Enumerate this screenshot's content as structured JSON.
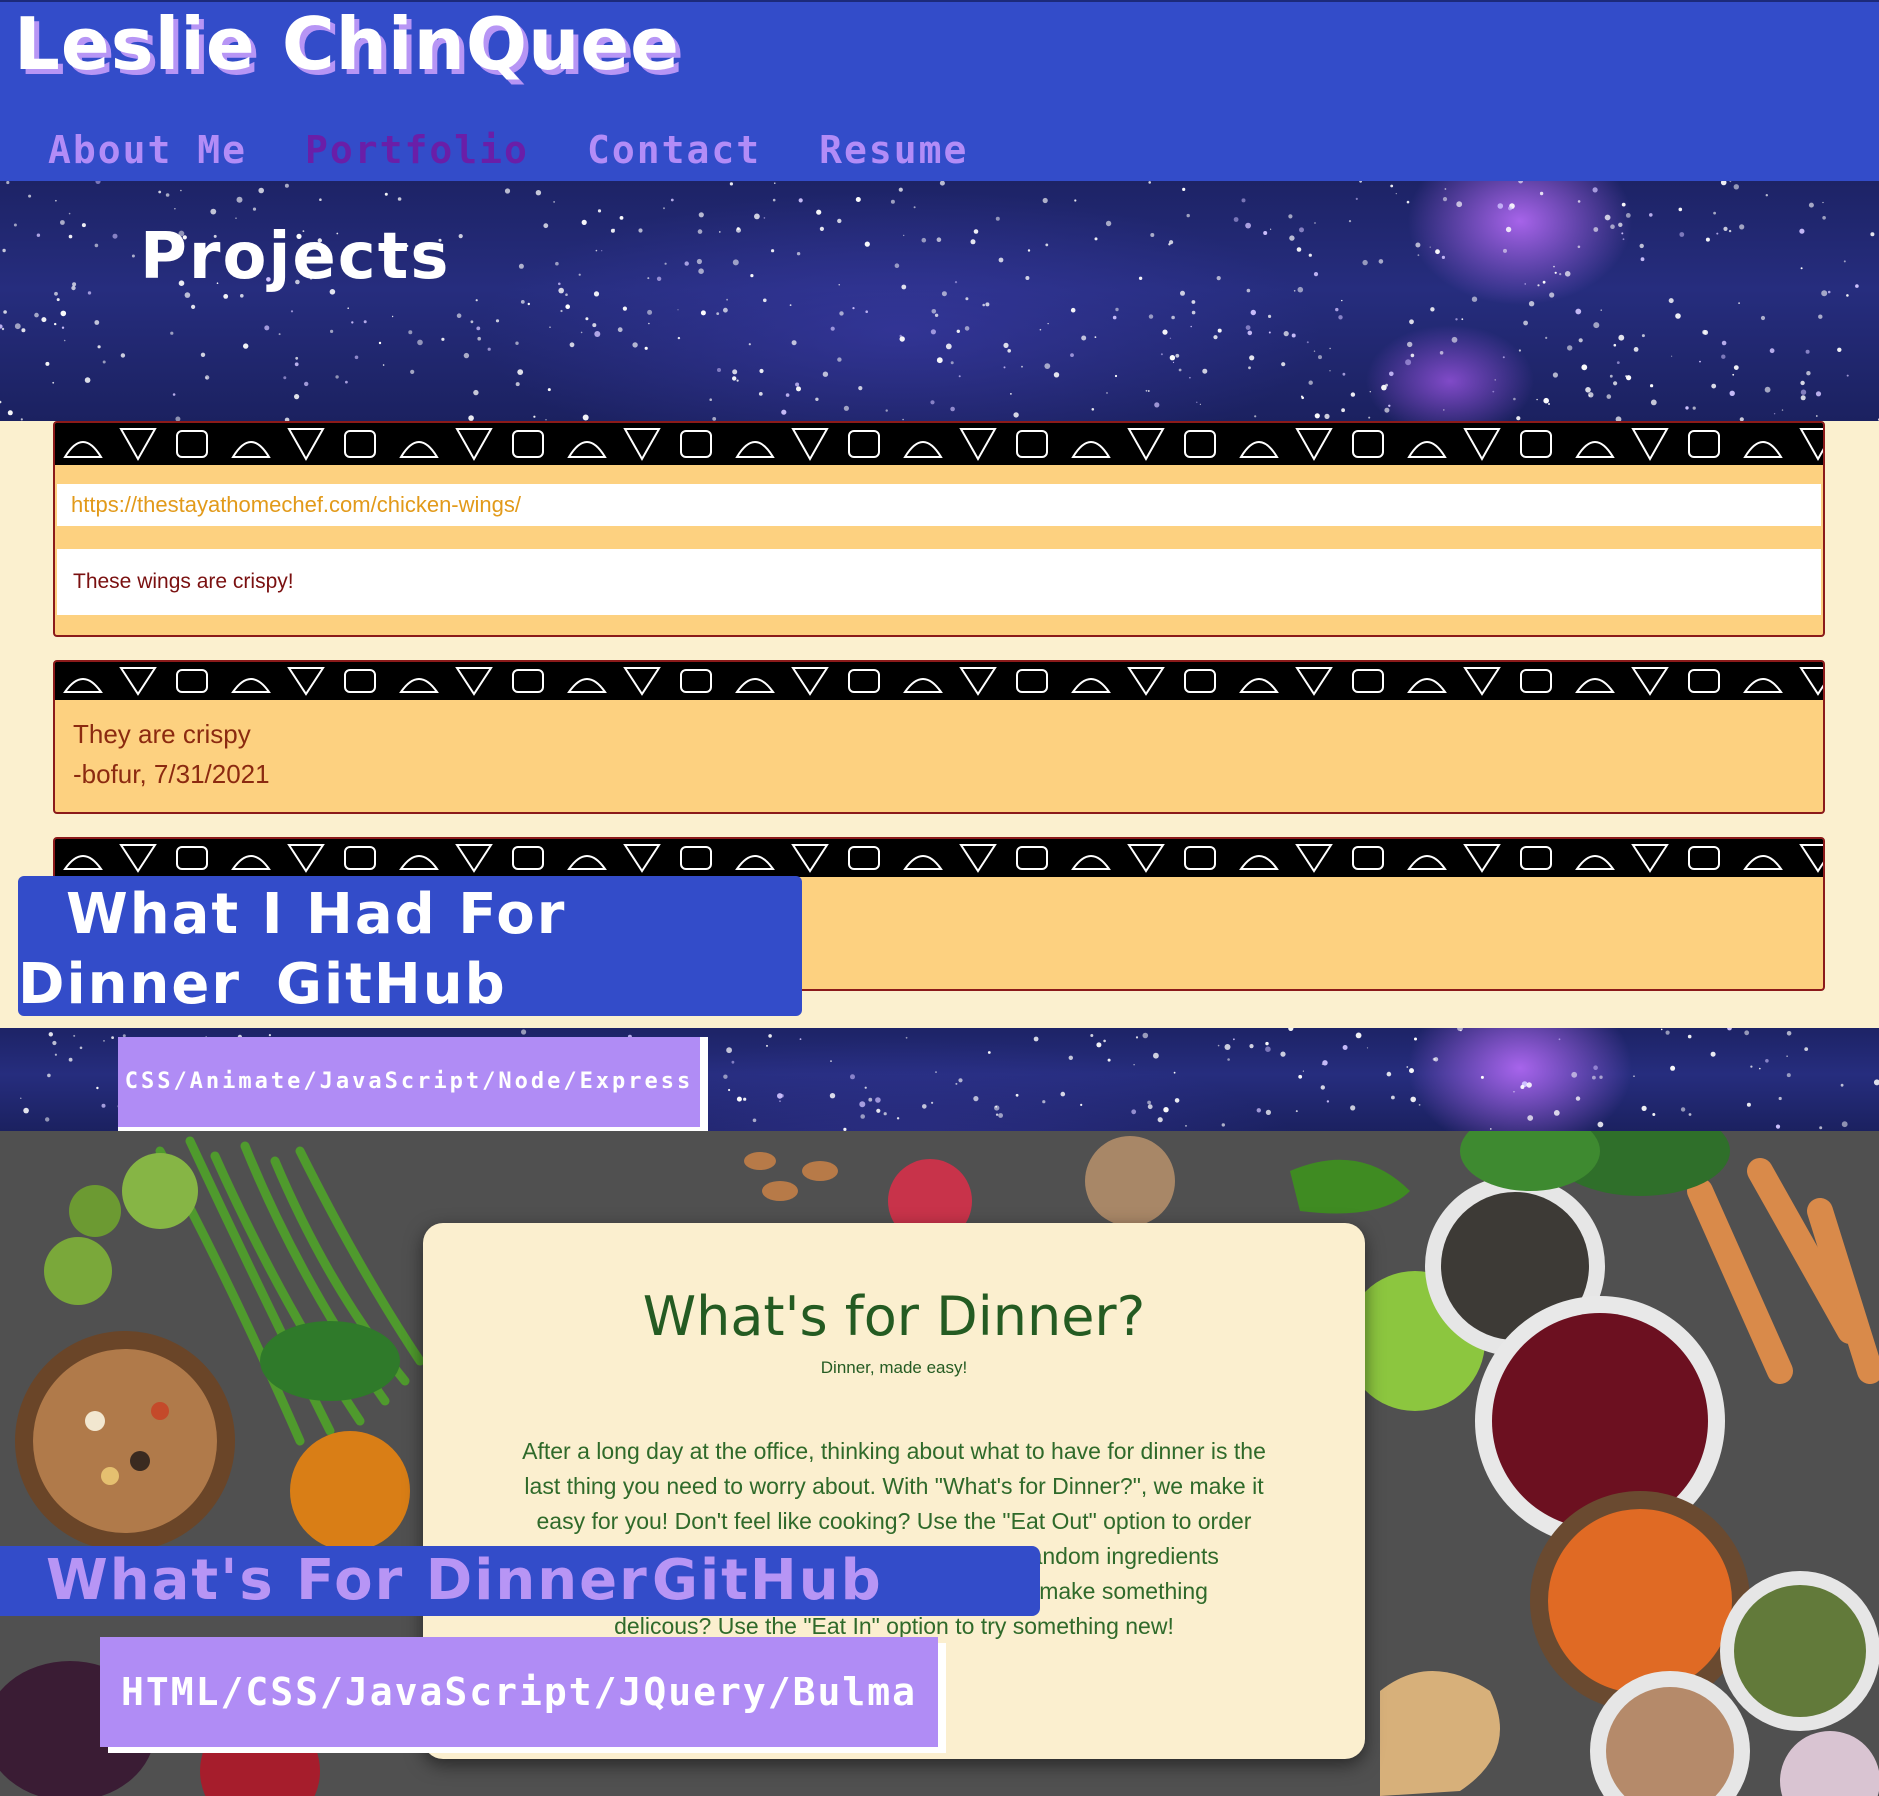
{
  "header": {
    "site_title": "Leslie ChinQuee",
    "nav": [
      {
        "label": "About Me",
        "active": false
      },
      {
        "label": "Portfolio",
        "active": true
      },
      {
        "label": "Contact",
        "active": false
      },
      {
        "label": "Resume",
        "active": false
      }
    ]
  },
  "projects_heading": "Projects",
  "project_1": {
    "preview": {
      "url": "https://thestayathomechef.com/chicken-wings/",
      "comment_input": "These wings are crispy!",
      "comment_card": {
        "text": "They are crispy",
        "author_line": "-bofur, 7/31/2021"
      }
    },
    "title_line_1": "What I Had For",
    "title_line_2": "Dinner",
    "github_label": "GitHub",
    "tech": "CSS/Animate/JavaScript/Node/Express"
  },
  "project_2": {
    "preview": {
      "title": "What's for Dinner?",
      "subtitle": "Dinner, made easy!",
      "description_lines": [
        "After a long day at the office, thinking about what to have for dinner is the",
        "last thing you need to worry about. With \"What's for Dinner?\", we make it",
        "easy for you! Don't feel like cooking? Use the \"Eat Out\" option to order",
        "f random ingredients",
        "o make something",
        "delicous? Use the \"Eat In\" option to try something new!"
      ]
    },
    "title": "What's For Dinner",
    "github_label": "GitHub",
    "tech": "HTML/CSS/JavaScript/JQuery/Bulma"
  },
  "colors": {
    "header_blue": "#334cc9",
    "accent_purple": "#b795f5",
    "active_nav": "#6a1ea8",
    "page_cream": "#fbf0cf",
    "card_orange": "#fdd180",
    "dinner_green": "#245b22"
  }
}
